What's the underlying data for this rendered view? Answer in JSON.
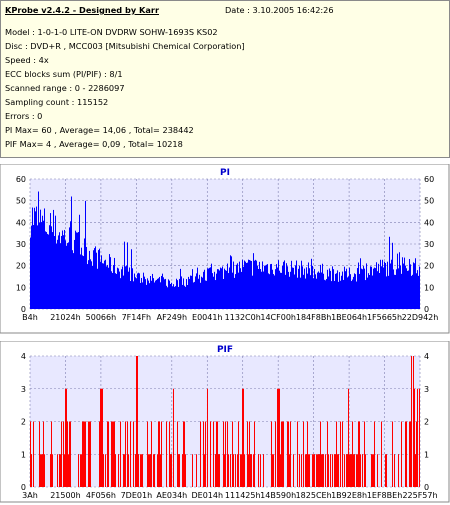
{
  "header": {
    "app_title": "KProbe v2.4.2 - Designed by Karr",
    "date_label": "Date : 3.10.2005 16:42:26",
    "lines": [
      "Model : 1-0-1-0 LITE-ON DVDRW SOHW-1693S KS02",
      "Disc : DVD+R , MCC003 [Mitsubishi Chemical Corporation]",
      "Speed : 4x",
      "ECC blocks sum (PI/PIF) : 8/1",
      "Scanned range : 0 - 2286097",
      "Sampling count : 115152",
      "Errors : 0",
      "PI Max= 60 , Average= 14,06 , Total= 238442",
      "PIF Max= 4 , Average= 0,09 , Total= 10218"
    ]
  },
  "colors": {
    "panel_bg": "#ffffe6",
    "plot_bg": "#e8e8ff",
    "pi_bar": "#0000ff",
    "pif_bar": "#ff0000",
    "title_color": "#0000cc"
  },
  "chart_data": [
    {
      "type": "bar",
      "title": "PI",
      "ylim": [
        0,
        60
      ],
      "yticks": [
        0,
        10,
        20,
        30,
        40,
        50,
        60
      ],
      "xticks": [
        "B4h",
        "21024h",
        "50066h",
        "7F14Fh",
        "AF249h",
        "E0041h",
        "1132C0h",
        "14CF00h",
        "184F8Bh",
        "1BE064h",
        "1F5665h",
        "22D942h"
      ],
      "grid": true,
      "profile_summary": {
        "max": 60,
        "average": 14.06,
        "segments": [
          {
            "x_from": "B4h",
            "x_to": "21024h",
            "typical": 44,
            "peak": 60
          },
          {
            "x_from": "21024h",
            "x_to": "50066h",
            "typical": 34,
            "peak": 52
          },
          {
            "x_from": "50066h",
            "x_to": "7F14Fh",
            "typical": 23,
            "peak": 35
          },
          {
            "x_from": "7F14Fh",
            "x_to": "AF249h",
            "typical": 15,
            "peak": 23
          },
          {
            "x_from": "AF249h",
            "x_to": "E0041h",
            "typical": 12,
            "peak": 21
          },
          {
            "x_from": "E0041h",
            "x_to": "1132C0h",
            "typical": 16,
            "peak": 26
          },
          {
            "x_from": "1132C0h",
            "x_to": "14CF00h",
            "typical": 20,
            "peak": 30
          },
          {
            "x_from": "14CF00h",
            "x_to": "184F8Bh",
            "typical": 20,
            "peak": 27
          },
          {
            "x_from": "184F8Bh",
            "x_to": "1BE064h",
            "typical": 18,
            "peak": 25
          },
          {
            "x_from": "1BE064h",
            "x_to": "1F5665h",
            "typical": 16,
            "peak": 24
          },
          {
            "x_from": "1F5665h",
            "x_to": "22D942h",
            "typical": 20,
            "peak": 34
          }
        ]
      }
    },
    {
      "type": "bar",
      "title": "PIF",
      "ylim": [
        0,
        4
      ],
      "yticks": [
        0,
        1,
        2,
        3,
        4
      ],
      "xticks": [
        "3Ah",
        "21500h",
        "4F056h",
        "7DE01h",
        "AE034h",
        "DE014h",
        "111425h",
        "14B590h",
        "1825CEh",
        "1B92E8h",
        "1EF8BEh",
        "225F57h"
      ],
      "grid": true,
      "profile_summary": {
        "max": 4,
        "average": 0.09,
        "level_4_near": [
          "7DE01h",
          "225F57h"
        ],
        "level_3_near": [
          "21500h",
          "4F056h",
          "AE034h",
          "DE014h",
          "111425h",
          "14B590h",
          "1825CEh",
          "1B92E8h",
          "225F57h"
        ]
      }
    }
  ]
}
